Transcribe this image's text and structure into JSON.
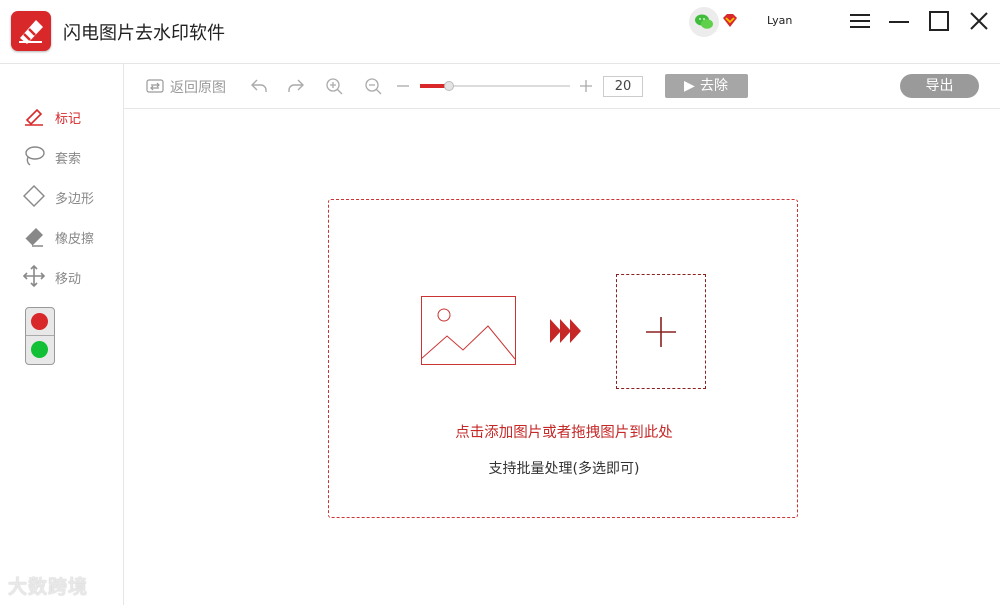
{
  "app": {
    "title": "闪电图片去水印软件",
    "user": "Lyan",
    "accent": "#d8282a"
  },
  "toolbar": {
    "back_label": "返回原图",
    "brush_size": "20",
    "brush_size_fraction": 0.18,
    "remove_label": "去除",
    "export_label": "导出",
    "icons": [
      "restore-icon",
      "undo-icon",
      "redo-icon",
      "zoom-in-icon",
      "zoom-out-icon",
      "minus-icon",
      "plus-icon",
      "play-icon"
    ]
  },
  "sidebar": {
    "items": [
      {
        "label": "标记",
        "icon": "marker-pen-icon",
        "active": true
      },
      {
        "label": "套索",
        "icon": "lasso-icon",
        "active": false
      },
      {
        "label": "多边形",
        "icon": "polygon-icon",
        "active": false
      },
      {
        "label": "橡皮擦",
        "icon": "eraser-icon",
        "active": false
      },
      {
        "label": "移动",
        "icon": "move-arrows-icon",
        "active": false
      }
    ],
    "lights": {
      "top": "#d8282a",
      "bottom": "#11c035"
    }
  },
  "drop_zone": {
    "main_text": "点击添加图片或者拖拽图片到此处",
    "sub_text": "支持批量处理(多选即可)"
  },
  "watermark": "大数跨境"
}
